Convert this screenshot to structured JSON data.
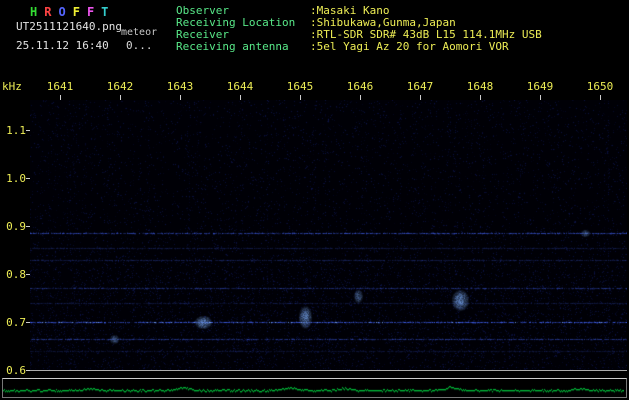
{
  "header": {
    "title_letters": [
      "H",
      "R",
      "O",
      "F",
      "F",
      "T"
    ],
    "title_colors": [
      "#33dd33",
      "#ff4444",
      "#5566ff",
      "#eeee33",
      "#ee55ee",
      "#33cccc"
    ],
    "filename": "UT2511121640.png",
    "mode": "meteor",
    "datetime": "25.11.12 16:40",
    "counter": "0...",
    "info": [
      {
        "label": "Observer",
        "value": ":Masaki Kano"
      },
      {
        "label": "Receiving Location",
        "value": ":Shibukawa,Gunma,Japan"
      },
      {
        "label": "Receiver",
        "value": ":RTL-SDR SDR# 43dB L15 114.1MHz USB"
      },
      {
        "label": "Receiving antenna",
        "value": ":5el Yagi Az 20 for Aomori VOR"
      }
    ]
  },
  "spectrogram": {
    "unit_label": "kHz",
    "x_ticks": [
      "1641",
      "1642",
      "1643",
      "1644",
      "1645",
      "1646",
      "1647",
      "1648",
      "1649",
      "1650"
    ],
    "y_ticks": [
      "1.1",
      "1.0",
      "0.9",
      "0.8",
      "0.7",
      "0.6"
    ],
    "y_range_khz": [
      0.6,
      1.1625
    ],
    "carriers": [
      {
        "khz": 0.885,
        "strength": 0.75
      },
      {
        "khz": 0.855,
        "strength": 0.3
      },
      {
        "khz": 0.83,
        "strength": 0.35
      },
      {
        "khz": 0.77,
        "strength": 0.55
      },
      {
        "khz": 0.74,
        "strength": 0.3
      },
      {
        "khz": 0.7,
        "strength": 0.95
      },
      {
        "khz": 0.665,
        "strength": 0.6
      },
      {
        "khz": 0.64,
        "strength": 0.25
      }
    ],
    "echoes": [
      {
        "t_frac": 0.14,
        "khz": 0.665,
        "w": 5,
        "h": 5,
        "strength": 0.55
      },
      {
        "t_frac": 0.29,
        "khz": 0.7,
        "w": 9,
        "h": 7,
        "strength": 0.85
      },
      {
        "t_frac": 0.46,
        "khz": 0.71,
        "w": 7,
        "h": 12,
        "strength": 0.8
      },
      {
        "t_frac": 0.55,
        "khz": 0.755,
        "w": 5,
        "h": 7,
        "strength": 0.6
      },
      {
        "t_frac": 0.72,
        "khz": 0.745,
        "w": 9,
        "h": 11,
        "strength": 0.85
      },
      {
        "t_frac": 0.93,
        "khz": 0.885,
        "w": 5,
        "h": 4,
        "strength": 0.5
      }
    ],
    "colors": {
      "axis_label": "#eded55",
      "tick": "#cccccc",
      "background": "#000006",
      "noise_blue": "#2236c8",
      "carrier_blue": "#4466ff",
      "echo_blue": "#7fb0ff",
      "level_green": "#00c23a"
    }
  }
}
